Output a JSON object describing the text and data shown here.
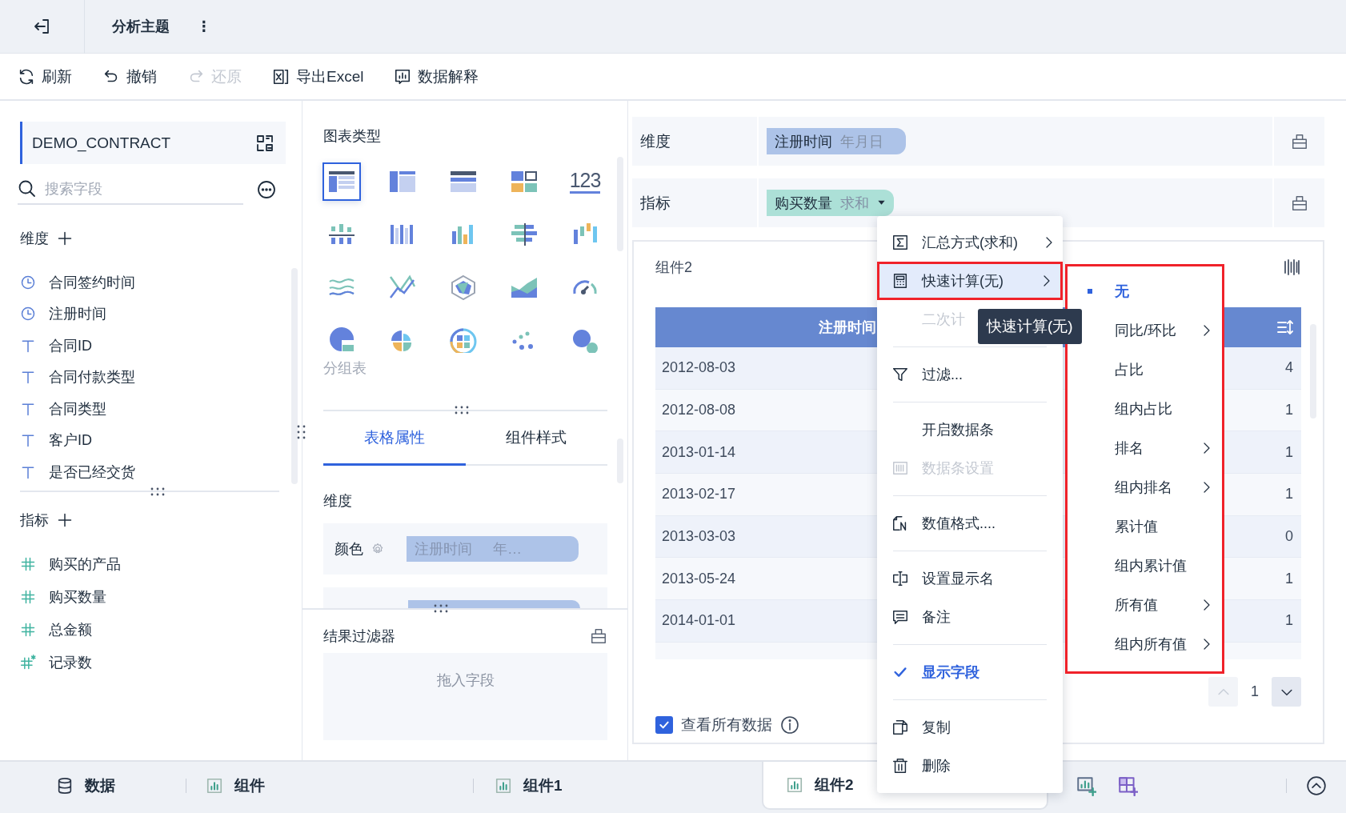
{
  "header": {
    "title": "分析主题",
    "more": "⋮"
  },
  "toolbar": [
    {
      "label": "刷新",
      "kind": "refresh",
      "disabled": false
    },
    {
      "label": "撤销",
      "kind": "undo",
      "disabled": false
    },
    {
      "label": "还原",
      "kind": "redo",
      "disabled": true
    },
    {
      "label": "导出Excel",
      "kind": "excel",
      "disabled": false
    },
    {
      "label": "数据解释",
      "kind": "explain",
      "disabled": false
    }
  ],
  "dataset": {
    "name": "DEMO_CONTRACT"
  },
  "search": {
    "placeholder": "搜索字段"
  },
  "dimensions": {
    "title": "维度",
    "fields": [
      {
        "name": "合同签约时间",
        "kind": "date"
      },
      {
        "name": "注册时间",
        "kind": "date"
      },
      {
        "name": "合同ID",
        "kind": "text"
      },
      {
        "name": "合同付款类型",
        "kind": "text"
      },
      {
        "name": "合同类型",
        "kind": "text"
      },
      {
        "name": "客户ID",
        "kind": "text"
      },
      {
        "name": "是否已经交货",
        "kind": "text"
      }
    ]
  },
  "measures": {
    "title": "指标",
    "fields": [
      {
        "name": "购买的产品",
        "kind": "number"
      },
      {
        "name": "购买数量",
        "kind": "number"
      },
      {
        "name": "总金额",
        "kind": "number"
      },
      {
        "name": "记录数",
        "kind": "count"
      }
    ]
  },
  "chart_types": {
    "title": "图表类型",
    "caption": "分组表",
    "items": [
      {
        "kind": "group-table",
        "selected": true
      },
      {
        "kind": "cross-table",
        "selected": false
      },
      {
        "kind": "detail-table",
        "selected": false
      },
      {
        "kind": "block",
        "selected": false
      },
      {
        "kind": "number",
        "selected": false,
        "label": "123"
      },
      {
        "kind": "stacked-column",
        "selected": false
      },
      {
        "kind": "multi-column",
        "selected": false
      },
      {
        "kind": "column",
        "selected": false
      },
      {
        "kind": "diverge-bar",
        "selected": false
      },
      {
        "kind": "range-column",
        "selected": false
      },
      {
        "kind": "multi-line",
        "selected": false
      },
      {
        "kind": "cross-line",
        "selected": false
      },
      {
        "kind": "radar",
        "selected": false
      },
      {
        "kind": "area",
        "selected": false
      },
      {
        "kind": "gauge",
        "selected": false
      },
      {
        "kind": "pie",
        "selected": false
      },
      {
        "kind": "rose",
        "selected": false
      },
      {
        "kind": "sunburst",
        "selected": false
      },
      {
        "kind": "scatter",
        "selected": false
      },
      {
        "kind": "bubble",
        "selected": false
      }
    ]
  },
  "property_tabs": [
    {
      "label": "表格属性",
      "selected": true
    },
    {
      "label": "组件样式",
      "selected": false
    }
  ],
  "properties": {
    "section": "维度",
    "rows": [
      {
        "kind": "field",
        "label": "颜色",
        "field": "注册时间",
        "suffix": "年…"
      },
      {
        "kind": "clipped"
      }
    ]
  },
  "result_filter": {
    "title": "结果过滤器",
    "placeholder": "拖入字段"
  },
  "shelves": [
    {
      "label": "维度",
      "chip": {
        "kind": "dimension",
        "field": "注册时间",
        "agg": "年月日",
        "dropdown": false
      }
    },
    {
      "label": "指标",
      "chip": {
        "kind": "measure",
        "field": "购买数量",
        "agg": "求和",
        "dropdown": true
      }
    }
  ],
  "component": {
    "title": "组件2",
    "table": {
      "columns": [
        {
          "label": "注册时间"
        },
        {
          "sortable": true
        }
      ],
      "rows": [
        [
          "2012-08-03",
          "4"
        ],
        [
          "2012-08-08",
          "1"
        ],
        [
          "2013-01-14",
          "1"
        ],
        [
          "2013-02-17",
          "1"
        ],
        [
          "2013-03-03",
          "0"
        ],
        [
          "2013-05-24",
          "1"
        ],
        [
          "2014-01-01",
          "1"
        ]
      ]
    },
    "pagination": {
      "page": "1"
    },
    "show_all": {
      "label": "查看所有数据",
      "checked": true
    }
  },
  "bottom_tabs": [
    {
      "label": "数据",
      "kind": "data",
      "selected": false
    },
    {
      "label": "组件",
      "kind": "chart",
      "selected": false
    },
    {
      "label": "组件1",
      "kind": "chart",
      "selected": false
    },
    {
      "label": "组件2",
      "kind": "chart",
      "selected": true
    }
  ],
  "context_menu": {
    "groups": [
      [
        {
          "label": "汇总方式(求和)",
          "kind": "sum",
          "submenu": true,
          "disabled": false,
          "highlighted": false,
          "checked": false,
          "outlined": false
        },
        {
          "label": "快速计算(无)",
          "kind": "calc",
          "submenu": true,
          "disabled": false,
          "highlighted": true,
          "checked": false,
          "outlined": true
        },
        {
          "label": "二次计",
          "kind": "none",
          "submenu": false,
          "disabled": true,
          "highlighted": false,
          "checked": false,
          "outlined": false
        }
      ],
      [
        {
          "label": "过滤...",
          "kind": "filter",
          "submenu": false,
          "disabled": false,
          "highlighted": false,
          "checked": false,
          "outlined": false
        }
      ],
      [
        {
          "label": "开启数据条",
          "kind": "none",
          "submenu": false,
          "disabled": false,
          "highlighted": false,
          "checked": false,
          "outlined": false
        },
        {
          "label": "数据条设置",
          "kind": "databar",
          "submenu": false,
          "disabled": true,
          "highlighted": false,
          "checked": false,
          "outlined": false
        }
      ],
      [
        {
          "label": "数值格式....",
          "kind": "format",
          "submenu": false,
          "disabled": false,
          "highlighted": false,
          "checked": false,
          "outlined": false
        }
      ],
      [
        {
          "label": "设置显示名",
          "kind": "rename",
          "submenu": false,
          "disabled": false,
          "highlighted": false,
          "checked": false,
          "outlined": false
        },
        {
          "label": "备注",
          "kind": "note",
          "submenu": false,
          "disabled": false,
          "highlighted": false,
          "checked": false,
          "outlined": false
        }
      ],
      [
        {
          "label": "显示字段",
          "kind": "check",
          "submenu": false,
          "disabled": false,
          "highlighted": false,
          "checked": true,
          "outlined": false
        }
      ],
      [
        {
          "label": "复制",
          "kind": "copy",
          "submenu": false,
          "disabled": false,
          "highlighted": false,
          "checked": false,
          "outlined": false
        },
        {
          "label": "删除",
          "kind": "delete",
          "submenu": false,
          "disabled": false,
          "highlighted": false,
          "checked": false,
          "outlined": false
        }
      ]
    ]
  },
  "tooltip": {
    "text": "快速计算(无)"
  },
  "submenu": {
    "outlined": true,
    "items": [
      {
        "label": "无",
        "selected": true,
        "submenu": false
      },
      {
        "label": "同比/环比",
        "selected": false,
        "submenu": true
      },
      {
        "label": "占比",
        "selected": false,
        "submenu": false
      },
      {
        "label": "组内占比",
        "selected": false,
        "submenu": false
      },
      {
        "label": "排名",
        "selected": false,
        "submenu": true
      },
      {
        "label": "组内排名",
        "selected": false,
        "submenu": true
      },
      {
        "label": "累计值",
        "selected": false,
        "submenu": false
      },
      {
        "label": "组内累计值",
        "selected": false,
        "submenu": false
      },
      {
        "label": "所有值",
        "selected": false,
        "submenu": true
      },
      {
        "label": "组内所有值",
        "selected": false,
        "submenu": true
      }
    ]
  }
}
